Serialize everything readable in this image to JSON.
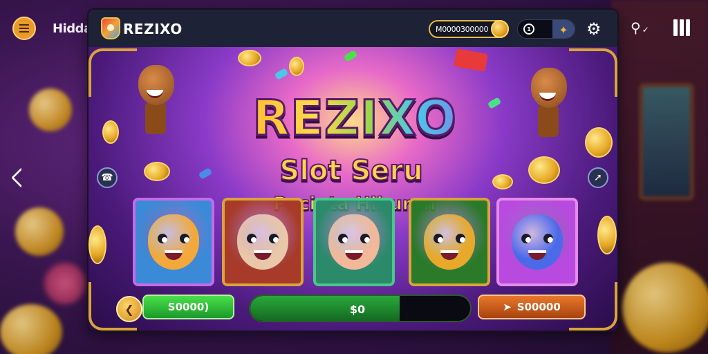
{
  "outer": {
    "brand": "Hidda"
  },
  "header": {
    "brand": "REZIXO",
    "balance": "M0000300000",
    "toggle_value": "1"
  },
  "hero": {
    "title": "REZIXO",
    "subtitle": "Slot Seru",
    "tagline": "Pecinta Hiburan"
  },
  "controls": {
    "bet_value": "S0000)",
    "win_value": "$0",
    "win_progress": 0.68,
    "total_value": "S00000"
  },
  "reels": [
    {
      "symbol": "orange-fox-icon",
      "bg": "#3a8ad8",
      "border": "#c86ae8",
      "face": "#f2a83a"
    },
    {
      "symbol": "llama-icon",
      "bg": "#a83a2a",
      "border": "#d9a43a",
      "face": "#e8c8a8"
    },
    {
      "symbol": "helmet-girl-icon",
      "bg": "#2a8a6a",
      "border": "#4ac88a",
      "face": "#f2b89a"
    },
    {
      "symbol": "goblin-icon",
      "bg": "#2a7a2a",
      "border": "#d9a43a",
      "face": "#e8a82a"
    },
    {
      "symbol": "blue-cat-icon",
      "bg": "#b84ae0",
      "border": "#e88ae8",
      "face": "#4a6ae8"
    }
  ],
  "colors": {
    "accent_gold": "#e8b84a",
    "topbar": "#1e2236",
    "green_button": "#2aa83a",
    "orange_button": "#c85a1a"
  }
}
